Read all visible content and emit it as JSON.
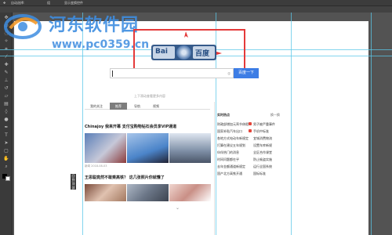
{
  "optbar": {
    "item1": "自动选择:",
    "item2": "组",
    "item3": "显示变换控件"
  },
  "watermark": {
    "title": "河东软件园",
    "url": "www.pc0359.cn"
  },
  "logo": {
    "left": "Bai",
    "right": "百度"
  },
  "search": {
    "button_label": "百度一下",
    "placeholder": ""
  },
  "hint": "上下滑动查看更多内容",
  "tabs": [
    "我的关注",
    "推荐",
    "导航",
    "视频"
  ],
  "feed": {
    "headline1": "Chinajoy 我来开幕 支付宝购物钻石会员享VIP通道",
    "meta1": "新闻  2018-08-03",
    "headline2": "王思聪竟然不敢乘高铁？ 这几张照片你就懂了"
  },
  "right": {
    "title": "实时热点",
    "refresh": "换一换",
    "items_left": [
      "财政部增加元宵节休假",
      "国家补贴汽车出口",
      "各地方式电动车新规定",
      "打算在建议五年规划",
      "伙伴热门的消息",
      "时间问题都在乎",
      "去年金额通道新规定",
      "国产北方高铁开通"
    ],
    "items_right": [
      "男子被严重事件",
      "手机中标准",
      "宜城消费物流",
      "设置车库新规",
      "全区合作课堂",
      "防止偷盗实施",
      "运行全国系统",
      "国标标准"
    ]
  },
  "side_tab": "回到顶部"
}
